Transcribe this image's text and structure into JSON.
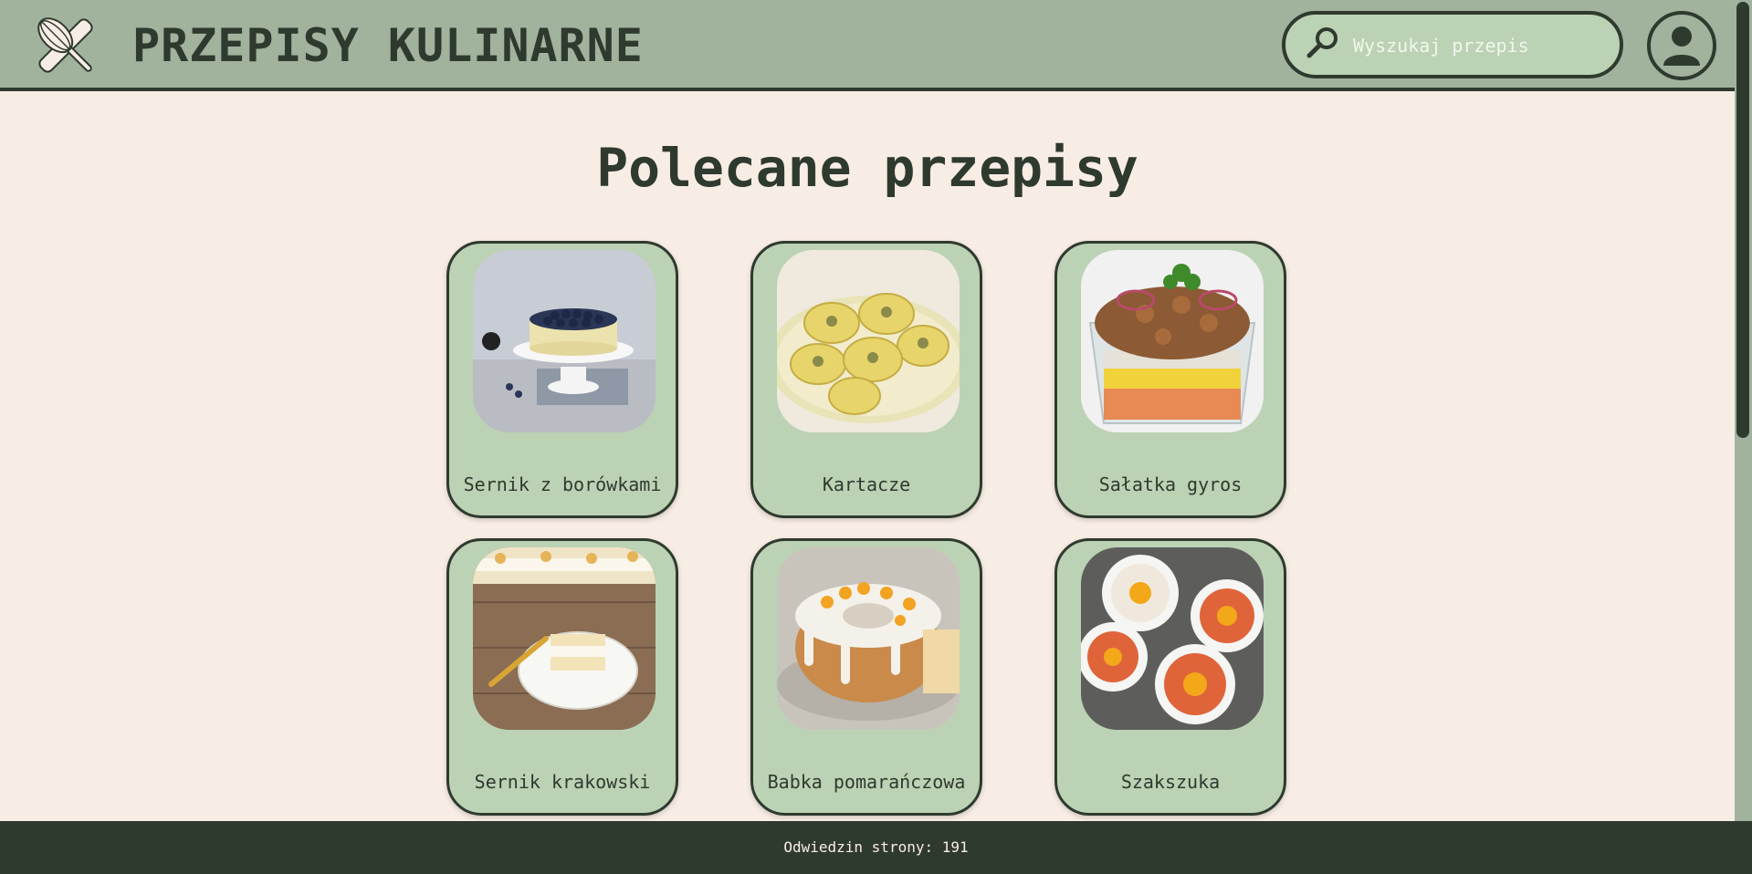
{
  "header": {
    "title": "PRZEPISY KULINARNE",
    "logo_icon": "whisk-and-rolling-pin-icon",
    "search": {
      "placeholder": "Wyszukaj przepis",
      "value": "",
      "icon": "search-icon"
    },
    "avatar_icon": "user-icon"
  },
  "main": {
    "title": "Polecane przepisy",
    "recipes": [
      {
        "label": "Sernik z borówkami",
        "image": "blueberry-cheesecake"
      },
      {
        "label": "Kartacze",
        "image": "potato-dumplings"
      },
      {
        "label": "Sałatka gyros",
        "image": "gyros-salad"
      },
      {
        "label": "Sernik krakowski",
        "image": "krakow-cheesecake"
      },
      {
        "label": "Babka pomarańczowa",
        "image": "orange-bundt-cake"
      },
      {
        "label": "Szakszuka",
        "image": "shakshuka"
      }
    ]
  },
  "footer": {
    "text": "Odwiedzin strony: 191"
  },
  "colors": {
    "header_bg": "#a1b29d",
    "page_bg": "#f8ede4",
    "card_bg": "#bcd2b4",
    "dark": "#2f3a2f"
  }
}
